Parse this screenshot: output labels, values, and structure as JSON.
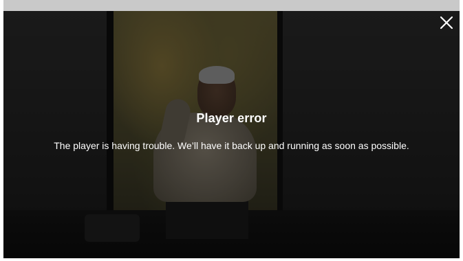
{
  "player": {
    "error": {
      "title": "Player error",
      "message": "The player is having trouble. We’ll have it back up and running as soon as possible."
    },
    "close_icon": "close-icon"
  },
  "colors": {
    "overlay": "#000000",
    "text": "#ffffff",
    "top_bar": "#c9c9c9"
  }
}
